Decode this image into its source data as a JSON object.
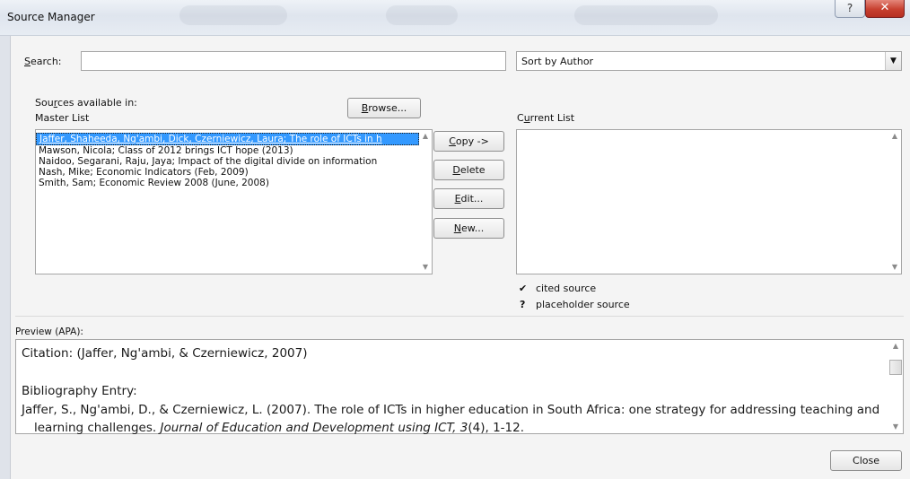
{
  "window": {
    "title": "Source Manager",
    "help_glyph": "?",
    "close_glyph": "✕"
  },
  "search": {
    "label": "Search:",
    "accelerator": "S",
    "label_rest": "earch:",
    "value": ""
  },
  "sort": {
    "selected": "Sort by Author",
    "arrow_glyph": "▼"
  },
  "sources_available": {
    "label_pre": "Sou",
    "label_accel": "r",
    "label_post": "ces available in:",
    "sublabel": "Master List"
  },
  "browse_button": {
    "accel": "B",
    "rest": "rowse..."
  },
  "master_list": {
    "items": [
      "Jaffer, Shaheeda, Ng'ambi, Dick, Czerniewicz, Laura; The role of ICTs in h",
      "Mawson, Nicola; Class of 2012 brings ICT hope (2013)",
      "Naidoo, Segarani, Raju, Jaya; Impact of the digital divide on information",
      "Nash, Mike; Economic Indicators (Feb, 2009)",
      "Smith, Sam; Economic Review 2008 (June, 2008)"
    ],
    "selected_index": 0
  },
  "actions": {
    "copy": {
      "accel": "C",
      "rest": "opy ->"
    },
    "delete": {
      "accel": "D",
      "rest": "elete"
    },
    "edit": {
      "accel": "E",
      "rest": "dit..."
    },
    "new": {
      "accel": "N",
      "rest": "ew..."
    }
  },
  "current_list": {
    "label_pre": "C",
    "label_accel": "u",
    "label_post": "rrent List",
    "items": []
  },
  "legend": {
    "cited": {
      "glyph": "✔",
      "text": "cited source"
    },
    "placeholder": {
      "glyph": "?",
      "text": "placeholder source"
    }
  },
  "preview": {
    "label": "Preview (APA):",
    "citation": "Citation:  (Jaffer, Ng'ambi, & Czerniewicz, 2007)",
    "bib_heading": "Bibliography Entry:",
    "bib_line1": "Jaffer, S., Ng'ambi, D., & Czerniewicz, L. (2007). The role of ICTs in higher education in South Africa: one strategy for addressing teaching and",
    "bib_line2_pre": "learning challenges. ",
    "bib_line2_journal": "Journal of Education and Development using ICT, 3",
    "bib_line2_post": "(4), 1-12."
  },
  "close_button": {
    "label": "Close"
  },
  "scroll_glyphs": {
    "up": "▲",
    "down": "▼"
  }
}
